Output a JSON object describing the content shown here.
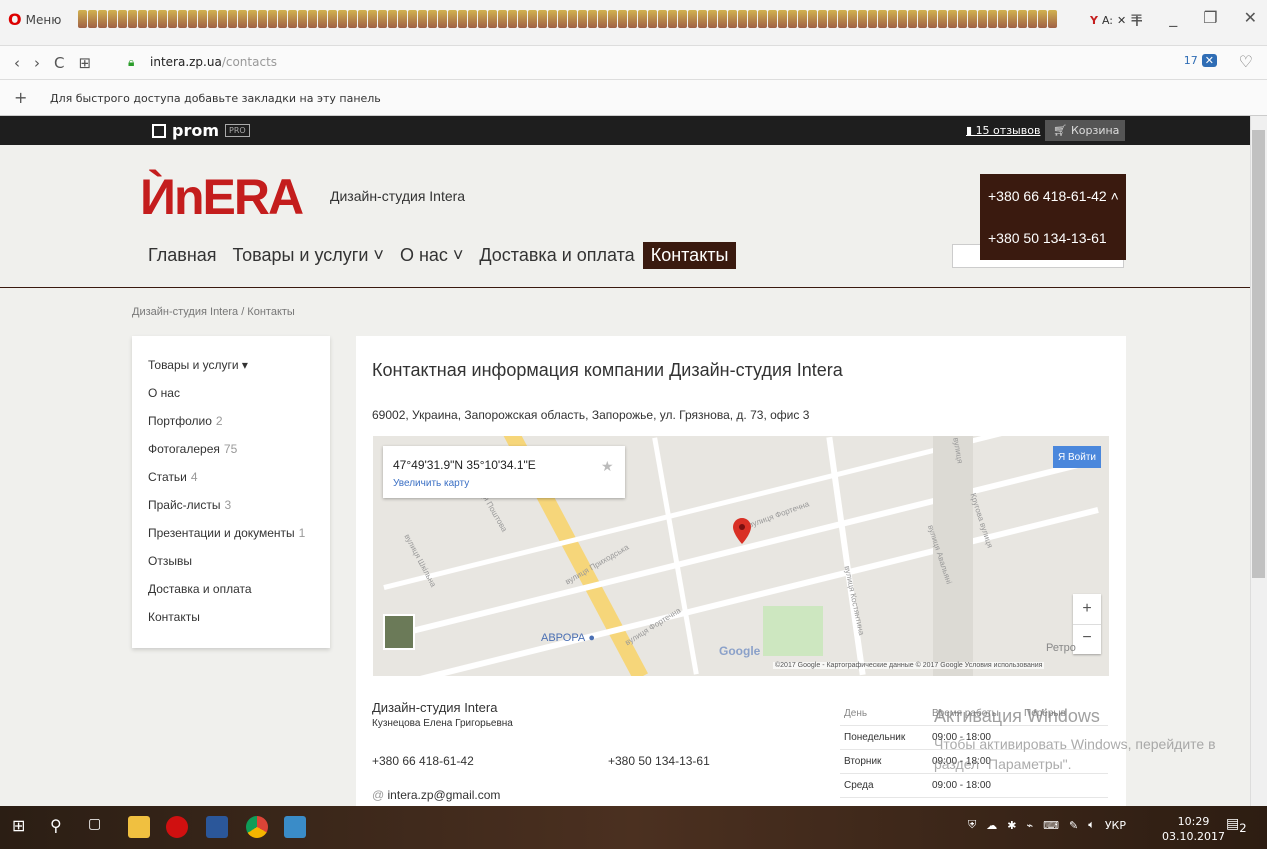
{
  "browser": {
    "menu_label": "Меню",
    "url_domain": "intera.zp.ua",
    "url_path": "/contacts",
    "badge_count": "17",
    "bookmarks_hint": "Для быстрого доступа добавьте закладки на эту панель",
    "active_tab_label": "A:"
  },
  "prom": {
    "logo": "prom",
    "pro": "PRO",
    "reviews": "15 отзывов",
    "cart": "Корзина"
  },
  "header": {
    "logo_text": "ЍnERA",
    "site_name": "Дизайн-студия Intera",
    "phone1": "+380 66 418-61-42 ˄",
    "phone2": "+380 50 134-13-61",
    "nav": [
      "Главная",
      "Товары и услуги ˅",
      "О нас ˅",
      "Доставка и оплата",
      "Контакты"
    ]
  },
  "breadcrumb": "Дизайн-студия Intera   /   Контакты",
  "sidebar": [
    {
      "label": "Товары и услуги ▾",
      "count": ""
    },
    {
      "label": "О нас",
      "count": ""
    },
    {
      "label": "Портфолио",
      "count": "2"
    },
    {
      "label": "Фотогалерея",
      "count": "75"
    },
    {
      "label": "Статьи",
      "count": "4"
    },
    {
      "label": "Прайс-листы",
      "count": "3"
    },
    {
      "label": "Презентации и документы",
      "count": "1"
    },
    {
      "label": "Отзывы",
      "count": ""
    },
    {
      "label": "Доставка и оплата",
      "count": ""
    },
    {
      "label": "Контакты",
      "count": ""
    }
  ],
  "main": {
    "title": "Контактная информация компании Дизайн-студия Intera",
    "address": "69002, Украина, Запорожская область, Запорожье, ул. Грязнова, д. 73, офис 3",
    "map": {
      "coords": "47°49'31.9\"N 35°10'34.1\"E",
      "enlarge": "Увеличить карту",
      "login": "Войти",
      "aurora": "АВРОРА",
      "google": "Google",
      "retro": "Ретро",
      "copyright": "©2017 Google - Картографические данные © 2017 Google   Условия использования",
      "streets": [
        "вулиця Фортечна",
        "вулиця Приходська",
        "вулиця Поштова",
        "вулиця Шкільна",
        "вулиця Фортечна",
        "вулиця Костянтина",
        "вулиця Авальяні",
        "Кругова вулиця",
        "вулиця"
      ]
    },
    "company": "Дизайн-студия Intera",
    "person": "Кузнецова Елена Григорьевна",
    "phone1": "+380 66 418-61-42",
    "phone2": "+380 50 134-13-61",
    "email": "intera.zp@gmail.com",
    "schedule": {
      "headers": [
        "День",
        "Время работы",
        "Перерыв"
      ],
      "rows": [
        {
          "day": "Понедельник",
          "time": "09:00 - 18:00"
        },
        {
          "day": "Вторник",
          "time": "09:00 - 18:00"
        },
        {
          "day": "Среда",
          "time": "09:00 - 18:00"
        }
      ]
    }
  },
  "watermark": {
    "line1": "Активация Windows",
    "line2": "Чтобы активировать Windows, перейдите в",
    "line3": "раздел \"Параметры\"."
  },
  "taskbar": {
    "lang": "УКР",
    "time": "10:29",
    "date": "03.10.2017",
    "notif": "2"
  }
}
